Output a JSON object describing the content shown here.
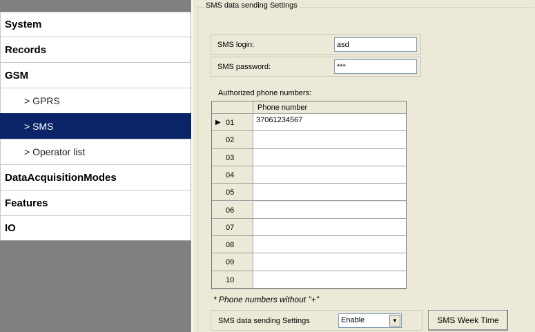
{
  "sidebar": {
    "items": [
      {
        "label": "System"
      },
      {
        "label": "Records"
      },
      {
        "label": "GSM"
      },
      {
        "label": "> GPRS"
      },
      {
        "label": "> SMS"
      },
      {
        "label": "> Operator list"
      },
      {
        "label": "DataAcquisitionModes"
      },
      {
        "label": "Features"
      },
      {
        "label": "IO"
      }
    ],
    "selected": "> SMS"
  },
  "group": {
    "title": "SMS data sending Settings"
  },
  "fields": {
    "login_label": "SMS login:",
    "login_value": "asd",
    "password_label": "SMS password:",
    "password_value": "***"
  },
  "authorized": {
    "label": "Authorized phone numbers:",
    "column": "Phone number",
    "rows": [
      {
        "index": "01",
        "number": "37061234567",
        "current": true
      },
      {
        "index": "02",
        "number": ""
      },
      {
        "index": "03",
        "number": ""
      },
      {
        "index": "04",
        "number": ""
      },
      {
        "index": "05",
        "number": ""
      },
      {
        "index": "06",
        "number": ""
      },
      {
        "index": "07",
        "number": ""
      },
      {
        "index": "08",
        "number": ""
      },
      {
        "index": "09",
        "number": ""
      },
      {
        "index": "10",
        "number": ""
      }
    ]
  },
  "note": "* Phone numbers without \"+\"",
  "sending": {
    "label": "SMS data sending Settings",
    "selected": "Enable"
  },
  "week_button": "SMS Week Time",
  "icons": {
    "row_indicator": "triangle-right-icon",
    "dropdown": "chevron-down-icon"
  },
  "colors": {
    "selected_nav": "#0a2467",
    "panel_bg": "#ece9d8"
  }
}
